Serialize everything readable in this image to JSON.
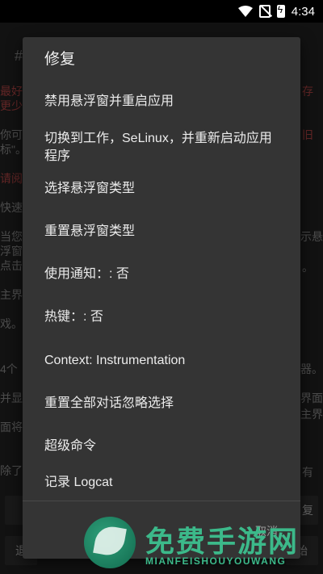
{
  "status_bar": {
    "time": "4:34",
    "icons": [
      "wifi-icon",
      "no-sim-icon",
      "battery-charging-icon"
    ]
  },
  "background": {
    "lines": [
      {
        "text": "#",
        "cls": "bg-dim"
      },
      {
        "text": "最好",
        "cls": "bg-red"
      },
      {
        "text": "更少",
        "cls": "bg-red"
      },
      {
        "text": "你可",
        "cls": "bg-dim"
      },
      {
        "text": "标\"。",
        "cls": "bg-dim"
      },
      {
        "text": "请阅",
        "cls": "bg-red"
      },
      {
        "text": "快速",
        "cls": "bg-dim"
      },
      {
        "text": "当您",
        "cls": "bg-dim"
      },
      {
        "text": "浮窗",
        "cls": "bg-dim"
      },
      {
        "text": "点击",
        "cls": "bg-dim"
      },
      {
        "text": "主界",
        "cls": "bg-dim"
      },
      {
        "text": "戏。",
        "cls": "bg-dim"
      },
      {
        "text": "4个",
        "cls": "bg-dim"
      },
      {
        "text": "并显",
        "cls": "bg-dim"
      },
      {
        "text": "面将",
        "cls": "bg-dim"
      },
      {
        "text": "除了",
        "cls": "bg-dim"
      },
      {
        "text": "存",
        "cls": "bg-red"
      },
      {
        "text": "旧",
        "cls": "bg-red"
      },
      {
        "text": "示悬",
        "cls": "bg-dim"
      },
      {
        "text": "。",
        "cls": "bg-dim"
      },
      {
        "text": "器。",
        "cls": "bg-dim"
      },
      {
        "text": "界面",
        "cls": "bg-dim"
      },
      {
        "text": "主界",
        "cls": "bg-dim"
      },
      {
        "text": "有",
        "cls": "bg-dim"
      }
    ],
    "buttons": {
      "exit": "退",
      "repair": "复",
      "go": "始"
    }
  },
  "menu": {
    "title": "修复",
    "items": [
      "禁用悬浮窗并重启应用",
      "切换到工作，SeLinux，并重新启动应用程序",
      "选择悬浮窗类型",
      "重置悬浮窗类型",
      "使用通知：: 否",
      "热键：: 否",
      "Context: Instrumentation",
      "重置全部对话忽略选择",
      "超级命令",
      "记录 Logcat"
    ],
    "cancel": "取消"
  },
  "watermark": {
    "title": "免费手游网",
    "subtitle": "MIANFEISHOUYOUWANG"
  }
}
